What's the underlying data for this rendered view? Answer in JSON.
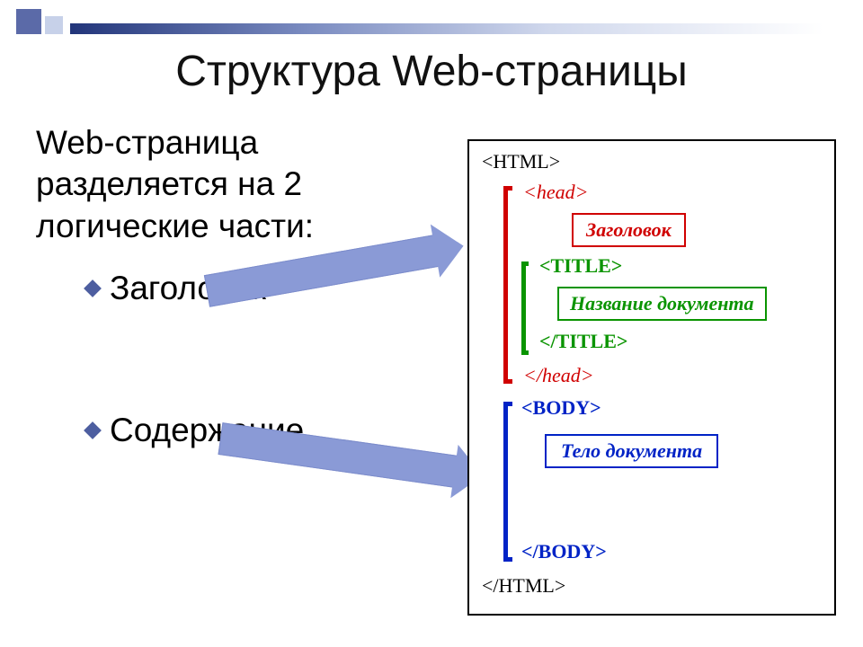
{
  "title": "Структура Web-страницы",
  "intro": "Web-страница разделяется на 2 логические части:",
  "bullets": {
    "b1": "Заголовок",
    "b2": "Содержание"
  },
  "diagram": {
    "html_open": "<HTML>",
    "head_open": "<head>",
    "head_label": "Заголовок",
    "title_open": "<TITLE>",
    "title_label": "Название документа",
    "title_close": "</TITLE>",
    "head_close": "</head>",
    "body_open": "<BODY>",
    "body_label": "Тело документа",
    "body_close": "</BODY>",
    "html_close": "</HTML>"
  }
}
